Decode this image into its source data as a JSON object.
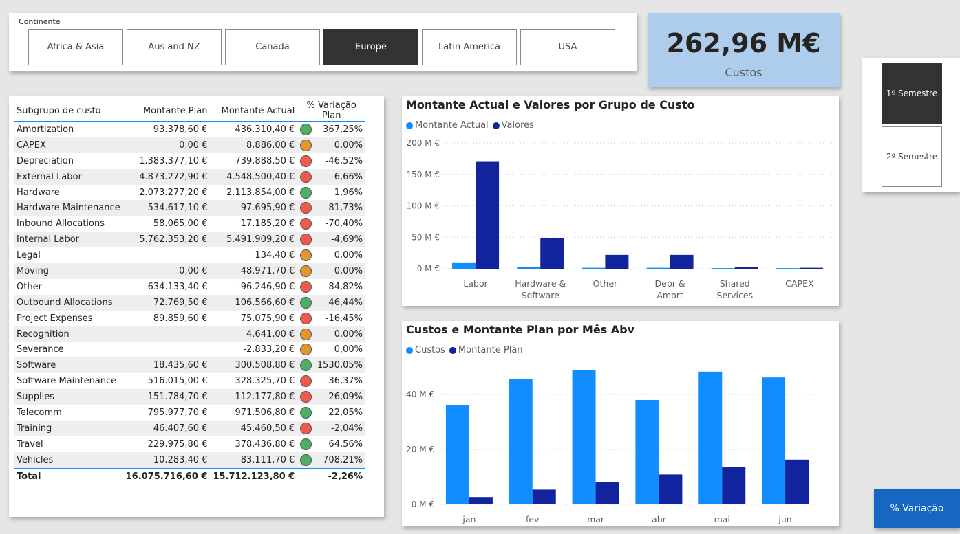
{
  "slicer": {
    "label": "Continente",
    "options": [
      "Africa & Asia",
      "Aus and NZ",
      "Canada",
      "Europe",
      "Latin America",
      "USA"
    ],
    "selected": "Europe"
  },
  "kpi": {
    "value": "262,96 M€",
    "caption": "Custos"
  },
  "semester": {
    "options": [
      "1º Semestre",
      "2º Semestre"
    ],
    "selected": "1º Semestre"
  },
  "table": {
    "headers": [
      "Subgrupo de custo",
      "Montante Plan",
      "Montante Actual",
      "% Variação Plan"
    ],
    "rows": [
      {
        "name": "Amortization",
        "plan": "93.378,60 €",
        "actual": "436.310,40 €",
        "status": "green",
        "pct": "367,25%"
      },
      {
        "name": "CAPEX",
        "plan": "0,00 €",
        "actual": "8.886,00 €",
        "status": "orange",
        "pct": "0,00%"
      },
      {
        "name": "Depreciation",
        "plan": "1.383.377,10 €",
        "actual": "739.888,50 €",
        "status": "red",
        "pct": "-46,52%"
      },
      {
        "name": "External Labor",
        "plan": "4.873.272,90 €",
        "actual": "4.548.500,40 €",
        "status": "red",
        "pct": "-6,66%"
      },
      {
        "name": "Hardware",
        "plan": "2.073.277,20 €",
        "actual": "2.113.854,00 €",
        "status": "green",
        "pct": "1,96%"
      },
      {
        "name": "Hardware Maintenance",
        "plan": "534.617,10 €",
        "actual": "97.695,90 €",
        "status": "red",
        "pct": "-81,73%"
      },
      {
        "name": "Inbound Allocations",
        "plan": "58.065,00 €",
        "actual": "17.185,20 €",
        "status": "red",
        "pct": "-70,40%"
      },
      {
        "name": "Internal Labor",
        "plan": "5.762.353,20 €",
        "actual": "5.491.909,20 €",
        "status": "red",
        "pct": "-4,69%"
      },
      {
        "name": "Legal",
        "plan": "",
        "actual": "134,40 €",
        "status": "orange",
        "pct": "0,00%"
      },
      {
        "name": "Moving",
        "plan": "0,00 €",
        "actual": "-48.971,70 €",
        "status": "orange",
        "pct": "0,00%"
      },
      {
        "name": "Other",
        "plan": "-634.133,40 €",
        "actual": "-96.246,90 €",
        "status": "red",
        "pct": "-84,82%"
      },
      {
        "name": "Outbound Allocations",
        "plan": "72.769,50 €",
        "actual": "106.566,60 €",
        "status": "green",
        "pct": "46,44%"
      },
      {
        "name": "Project Expenses",
        "plan": "89.859,60 €",
        "actual": "75.075,90 €",
        "status": "red",
        "pct": "-16,45%"
      },
      {
        "name": "Recognition",
        "plan": "",
        "actual": "4.641,00 €",
        "status": "orange",
        "pct": "0,00%"
      },
      {
        "name": "Severance",
        "plan": "",
        "actual": "-2.833,20 €",
        "status": "orange",
        "pct": "0,00%"
      },
      {
        "name": "Software",
        "plan": "18.435,60 €",
        "actual": "300.508,80 €",
        "status": "green",
        "pct": "1530,05%"
      },
      {
        "name": "Software Maintenance",
        "plan": "516.015,00 €",
        "actual": "328.325,70 €",
        "status": "red",
        "pct": "-36,37%"
      },
      {
        "name": "Supplies",
        "plan": "151.784,70 €",
        "actual": "112.177,80 €",
        "status": "red",
        "pct": "-26,09%"
      },
      {
        "name": "Telecomm",
        "plan": "795.977,70 €",
        "actual": "971.506,80 €",
        "status": "green",
        "pct": "22,05%"
      },
      {
        "name": "Training",
        "plan": "46.407,60 €",
        "actual": "45.460,50 €",
        "status": "red",
        "pct": "-2,04%"
      },
      {
        "name": "Travel",
        "plan": "229.975,80 €",
        "actual": "378.436,80 €",
        "status": "green",
        "pct": "64,56%"
      },
      {
        "name": "Vehicles",
        "plan": "10.283,40 €",
        "actual": "83.111,70 €",
        "status": "green",
        "pct": "708,21%"
      }
    ],
    "total": {
      "name": "Total",
      "plan": "16.075.716,60 €",
      "actual": "15.712.123,80 €",
      "pct": "-2,26%"
    }
  },
  "chart_data": [
    {
      "type": "bar",
      "title": "Montante Actual e Valores por Grupo de Custo",
      "categories": [
        [
          "Labor"
        ],
        [
          "Hardware &",
          "Software"
        ],
        [
          "Other"
        ],
        [
          "Depr &",
          "Amort"
        ],
        [
          "Shared",
          "Services"
        ],
        [
          "CAPEX"
        ]
      ],
      "series": [
        {
          "name": "Montante Actual",
          "color": "#118dff",
          "values": [
            10,
            3,
            1.5,
            1.5,
            1,
            1
          ]
        },
        {
          "name": "Valores",
          "color": "#12239e",
          "values": [
            171,
            49,
            22,
            22,
            2.5,
            1.5
          ]
        }
      ],
      "yticks": [
        "0 M €",
        "50 M €",
        "100 M €",
        "150 M €",
        "200 M €"
      ],
      "ytick_values": [
        0,
        50,
        100,
        150,
        200
      ],
      "ylim": [
        0,
        200
      ],
      "legend_position": "top-left",
      "grid": true
    },
    {
      "type": "bar",
      "title": "Custos e Montante Plan por Mês Abv",
      "categories": [
        [
          "jan"
        ],
        [
          "fev"
        ],
        [
          "mar"
        ],
        [
          "abr"
        ],
        [
          "mai"
        ],
        [
          "jun"
        ]
      ],
      "series": [
        {
          "name": "Custos",
          "color": "#118dff",
          "values": [
            36,
            45.5,
            48.8,
            38,
            48.3,
            46.2
          ]
        },
        {
          "name": "Montante Plan",
          "color": "#12239e",
          "values": [
            2.7,
            5.4,
            8.2,
            10.9,
            13.6,
            16.3
          ]
        }
      ],
      "yticks": [
        "0 M €",
        "20 M €",
        "40 M €"
      ],
      "ytick_values": [
        0,
        20,
        40
      ],
      "ylim": [
        0,
        50
      ],
      "legend_position": "top-left",
      "grid": true
    }
  ],
  "pct_button": {
    "label": "% Variação"
  }
}
